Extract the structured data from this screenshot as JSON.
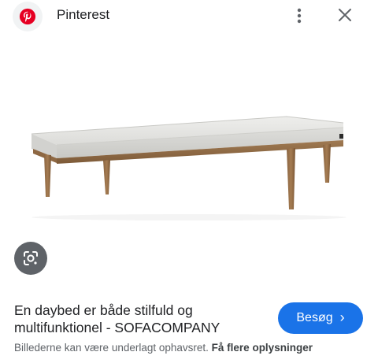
{
  "header": {
    "site_name": "Pinterest",
    "logo_icon": "pinterest-logo-icon",
    "more_icon": "more-vert-icon",
    "close_icon": "close-icon",
    "brand_color": "#e60023"
  },
  "image": {
    "subject": "daybed",
    "lens_icon": "google-lens-icon"
  },
  "result": {
    "title": "En daybed er både stilfuld og multifunktionel - SOFACOMPANY",
    "visit_label": "Besøg",
    "visit_icon": "chevron-right-icon",
    "button_color": "#1a73e8"
  },
  "footer": {
    "copyright_text": "Billederne kan være underlagt ophavsret.",
    "more_info_label": "Få flere oplysninger"
  }
}
